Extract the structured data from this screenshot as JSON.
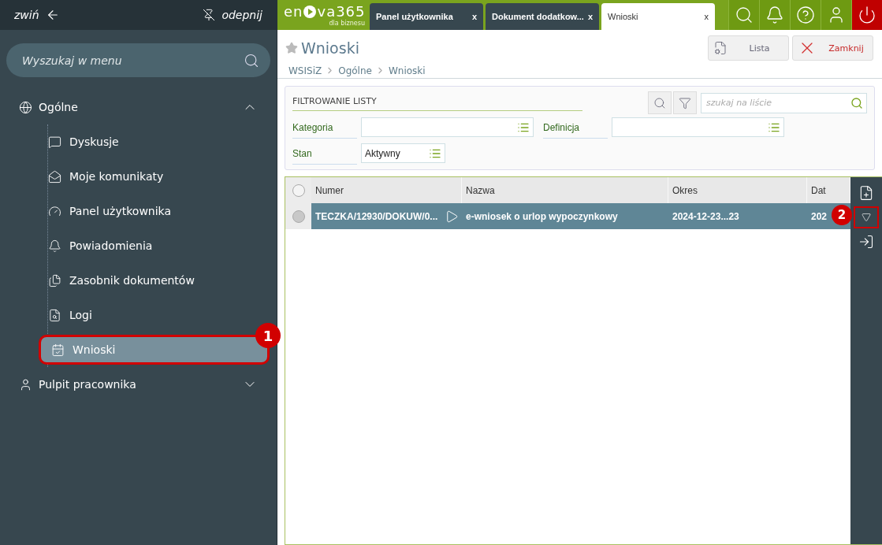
{
  "sidebar": {
    "collapse": "zwiń",
    "unpin": "odepnij",
    "search": {
      "placeholder": "Wyszukaj w menu"
    },
    "groups": [
      {
        "label": "Ogólne",
        "expanded": true,
        "items": [
          {
            "label": "Dyskusje",
            "selected": false
          },
          {
            "label": "Moje komunikaty",
            "selected": false
          },
          {
            "label": "Panel użytkownika",
            "selected": false
          },
          {
            "label": "Powiadomienia",
            "selected": false
          },
          {
            "label": "Zasobnik dokumentów",
            "selected": false
          },
          {
            "label": "Logi",
            "selected": false
          },
          {
            "label": "Wnioski",
            "selected": true,
            "callout": "1"
          }
        ]
      },
      {
        "label": "Pulpit pracownika",
        "expanded": false
      }
    ]
  },
  "logo": {
    "left": "en",
    "right": "va365",
    "tagline": "dla biznesu"
  },
  "tabs": [
    {
      "label": "Panel użytkownika",
      "close": "x",
      "selected": false
    },
    {
      "label": "Dokument dodatkow...",
      "close": "x",
      "selected": false
    },
    {
      "label": "Wnioski",
      "close": "x",
      "selected": true
    }
  ],
  "page": {
    "title": "Wnioski",
    "buttons": [
      {
        "label": "Lista",
        "kind": "list"
      },
      {
        "label": "Zamknij",
        "kind": "close"
      }
    ],
    "breadcrumb": [
      "WSISiZ",
      "Ogólne",
      "Wnioski"
    ]
  },
  "filter": {
    "title": "FILTROWANIE LISTY",
    "search": {
      "placeholder": "szukaj na liście"
    },
    "fields": [
      {
        "label": "Kategoria"
      },
      {
        "label": "Definicja"
      },
      {
        "label": "Stan",
        "value": "Aktywny"
      }
    ]
  },
  "table": {
    "all_selected": false,
    "columns": [
      "Numer",
      "Nazwa",
      "Okres",
      "Dat"
    ],
    "rows": [
      {
        "cells": [
          "TECZKA/12930/DOKUW/0...",
          "e-wniosek o urlop wypoczynkowy",
          "2024-12-23...23",
          "202"
        ],
        "selected": true
      }
    ]
  },
  "side_toolbar": [
    {
      "kind": "new"
    },
    {
      "kind": "dropdown",
      "callout": "2"
    },
    {
      "kind": "enter"
    }
  ]
}
